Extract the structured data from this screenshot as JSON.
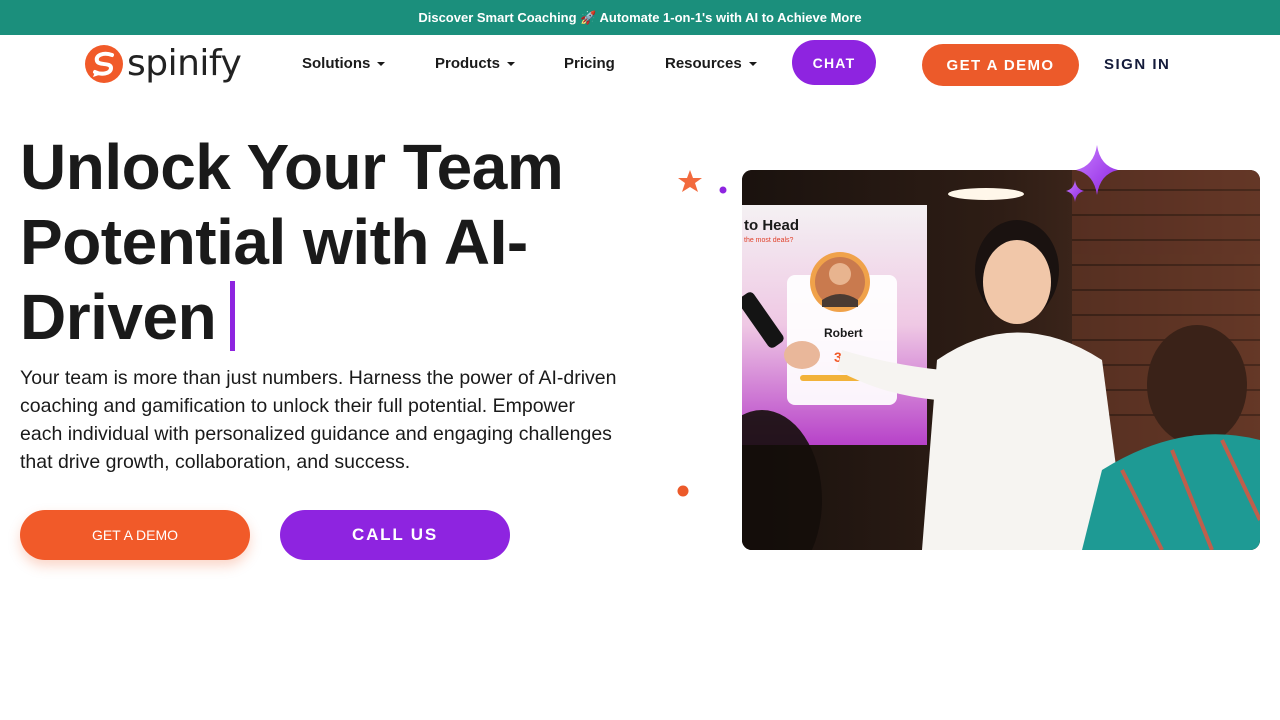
{
  "announcement": {
    "text": "Discover Smart Coaching 🚀 Automate 1-on-1's with AI to Achieve More"
  },
  "brand": {
    "name": "spinify",
    "accent_orange": "#f15a29",
    "accent_purple": "#8e24e0",
    "banner_teal": "#1b8f7c"
  },
  "nav": {
    "items": [
      {
        "label": "Solutions",
        "dropdown": true
      },
      {
        "label": "Products",
        "dropdown": true
      },
      {
        "label": "Pricing",
        "dropdown": false
      },
      {
        "label": "Resources",
        "dropdown": true
      }
    ],
    "chat_label": "CHAT",
    "demo_label": "GET A DEMO",
    "signin_label": "SIGN IN"
  },
  "hero": {
    "title": "Unlock Your Team Potential with AI-Driven",
    "subtitle": "Your team is more than just numbers. Harness the power of AI-driven coaching and gamification to unlock their full potential. Empower each individual with personalized guidance and engaging challenges that drive growth, collaboration, and success.",
    "cta_demo": "GET A DEMO",
    "cta_call": "CALL US"
  },
  "hero_image": {
    "screen_heading": "to Head",
    "screen_subheading": "the most deals?",
    "card_name": "Robert",
    "card_score": "39"
  }
}
